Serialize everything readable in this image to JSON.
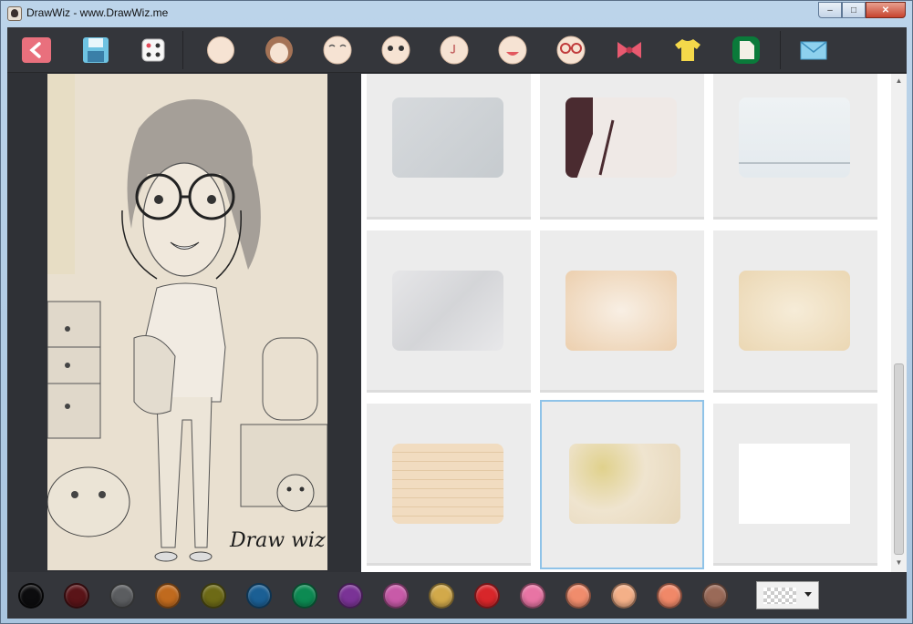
{
  "window": {
    "title": "DrawWiz - www.DrawWiz.me",
    "minimize": "–",
    "maximize": "□",
    "close": "✕"
  },
  "toolbar": {
    "items": [
      {
        "name": "back-icon"
      },
      {
        "name": "save-icon"
      },
      {
        "name": "dice-icon"
      },
      {
        "name": "face-shape-icon"
      },
      {
        "name": "hair-icon"
      },
      {
        "name": "eyebrows-icon"
      },
      {
        "name": "eyes-icon"
      },
      {
        "name": "nose-icon"
      },
      {
        "name": "mouth-icon"
      },
      {
        "name": "glasses-icon"
      },
      {
        "name": "bow-icon"
      },
      {
        "name": "shirt-icon"
      },
      {
        "name": "background-icon",
        "active": true
      },
      {
        "name": "mail-icon"
      }
    ]
  },
  "canvas": {
    "watermark": "Draw wiz"
  },
  "backgrounds": [
    {
      "name": "grey-paper"
    },
    {
      "name": "paper-with-pen"
    },
    {
      "name": "notebook-paper"
    },
    {
      "name": "crumpled-white-paper"
    },
    {
      "name": "cream-paper"
    },
    {
      "name": "old-yellow-paper"
    },
    {
      "name": "handwritten-letter"
    },
    {
      "name": "stained-paper",
      "selected": true
    },
    {
      "name": "plain-white"
    }
  ],
  "palette": {
    "colors": [
      "#0c0c0e",
      "#5a1418",
      "#5b5d60",
      "#c06a1e",
      "#6d6a16",
      "#1b5f94",
      "#0c8a52",
      "#7a3396",
      "#c85aa8",
      "#d2a94a",
      "#d8262a",
      "#e874a4",
      "#f08c6c",
      "#f4b088",
      "#f08868",
      "#9a6a58"
    ],
    "pattern_icon": "checkerboard-icon"
  }
}
